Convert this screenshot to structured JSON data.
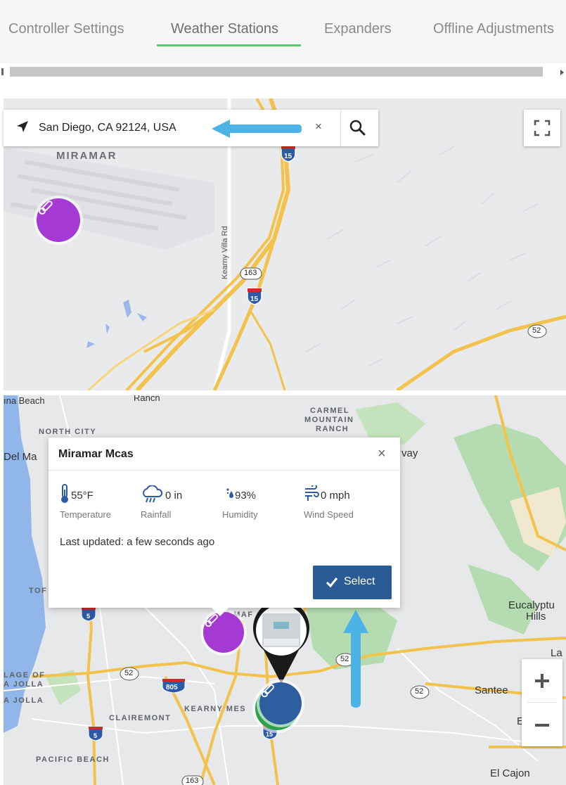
{
  "tabs": [
    {
      "label": "Controller Settings",
      "active": false
    },
    {
      "label": "Weather Stations",
      "active": true
    },
    {
      "label": "Expanders",
      "active": false
    },
    {
      "label": "Offline Adjustments",
      "active": false
    }
  ],
  "accent_color": "#5ac86e",
  "map_top": {
    "search": {
      "value": "San Diego, CA 92124, USA",
      "clear_label": "×"
    },
    "labels": {
      "area": "MIRAMAR",
      "road": "Kearny Villa Rd"
    },
    "shields": {
      "i15": "15",
      "sr163": "163",
      "sr52": "52"
    },
    "marker_color": "#a43ad3",
    "icons": [
      "location-arrow-icon",
      "search-icon",
      "fullscreen-icon",
      "thermometer-icon"
    ]
  },
  "map_bottom": {
    "labels": {
      "solana": "ına Beach",
      "ranch_top": "Rancn",
      "carmel1": "CARMEL",
      "carmel2": "MOUNTAIN",
      "carmel3": "RANCH",
      "north_city": "NORTH CITY",
      "del_mar": "Del Ma",
      "way": "vay",
      "tor": "TOF",
      "eucalyptus1": "Eucalyptu",
      "eucalyptus2": "Hills",
      "la_right": "La",
      "village1": "LAGE OF",
      "village2": "A JOLLA",
      "la_jolla": "A JOLLA",
      "clairemont": "CLAIREMONT",
      "kearny": "KEARNY MES",
      "miramar_partial": "M MAF",
      "santee": "Santee",
      "pacific_beach": "PACIFIC BEACH",
      "el_cajon": "El Cajon",
      "el_partial": "E"
    },
    "shields": {
      "i5_top": "5",
      "i5_bot": "5",
      "sr52a": "52",
      "sr52b": "52",
      "sr52c": "52",
      "i805": "805",
      "i15": "15",
      "sr163": "163"
    },
    "popup": {
      "title": "Miramar Mcas",
      "close_label": "×",
      "stats": [
        {
          "icon": "thermometer-icon",
          "value": "55°F",
          "label": "Temperature"
        },
        {
          "icon": "rain-cloud-icon",
          "value": "0 in",
          "label": "Rainfall"
        },
        {
          "icon": "humidity-drops-icon",
          "value": "93%",
          "label": "Humidity"
        },
        {
          "icon": "wind-icon",
          "value": "0 mph",
          "label": "Wind Speed"
        }
      ],
      "last_updated": "Last updated: a few seconds ago",
      "select_label": "Select"
    },
    "zoom": {
      "in_label": "+",
      "out_label": "−"
    },
    "colors": {
      "purple_marker": "#a43ad3",
      "blue_marker": "#2d5fa0",
      "green_marker": "#2aa14a",
      "annotation_arrow": "#4bb3e6",
      "select_button": "#2b5b94"
    }
  }
}
